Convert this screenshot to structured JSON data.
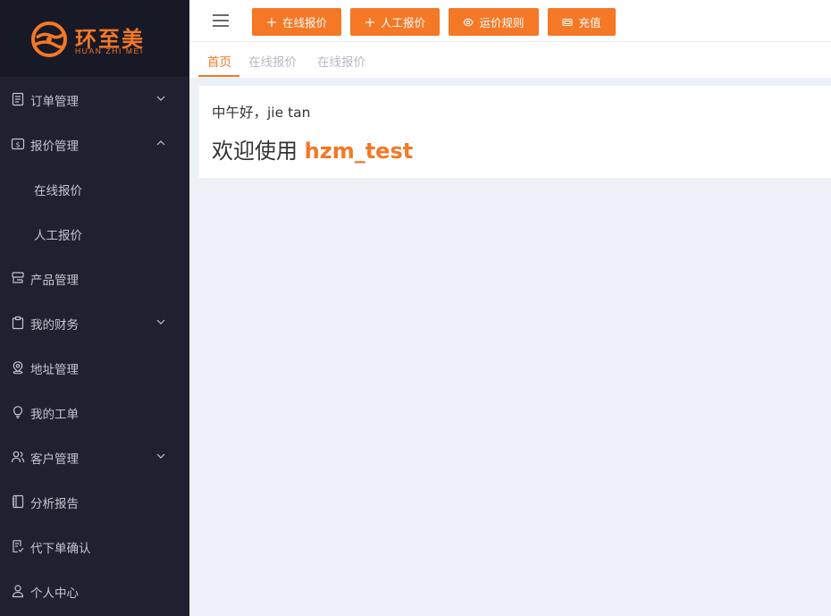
{
  "logo": {
    "cn": "环至美",
    "en": "HUAN ZHI MEI"
  },
  "sidebar": {
    "items": [
      {
        "label": "订单管理",
        "icon": "document-icon",
        "arrow": "down"
      },
      {
        "label": "报价管理",
        "icon": "dollar-square-icon",
        "arrow": "up"
      },
      {
        "label": "在线报价",
        "submenu": true
      },
      {
        "label": "人工报价",
        "submenu": true
      },
      {
        "label": "产品管理",
        "icon": "product-icon"
      },
      {
        "label": "我的财务",
        "icon": "clipboard-icon",
        "arrow": "down"
      },
      {
        "label": "地址管理",
        "icon": "location-icon"
      },
      {
        "label": "我的工单",
        "icon": "lightbulb-icon"
      },
      {
        "label": "客户管理",
        "icon": "users-icon",
        "arrow": "down"
      },
      {
        "label": "分析报告",
        "icon": "notebook-icon"
      },
      {
        "label": "代下单确认",
        "icon": "receipt-icon"
      },
      {
        "label": "个人中心",
        "icon": "user-icon"
      }
    ]
  },
  "toolbar": {
    "buttons": [
      {
        "label": "在线报价",
        "icon": "plus-icon"
      },
      {
        "label": "人工报价",
        "icon": "plus-icon"
      },
      {
        "label": "运价规则",
        "icon": "eye-icon"
      },
      {
        "label": "充值",
        "icon": "money-icon"
      }
    ]
  },
  "tabs": [
    {
      "label": "首页",
      "active": true
    },
    {
      "label": "在线报价"
    },
    {
      "label": "在线报价"
    }
  ],
  "content": {
    "greeting": "中午好，jie tan",
    "welcome_prefix": "欢迎使用",
    "brand": "hzm_test"
  },
  "colors": {
    "accent": "#f47826",
    "sidebar_bg": "#1f2030",
    "page_bg": "#eef0f7"
  }
}
